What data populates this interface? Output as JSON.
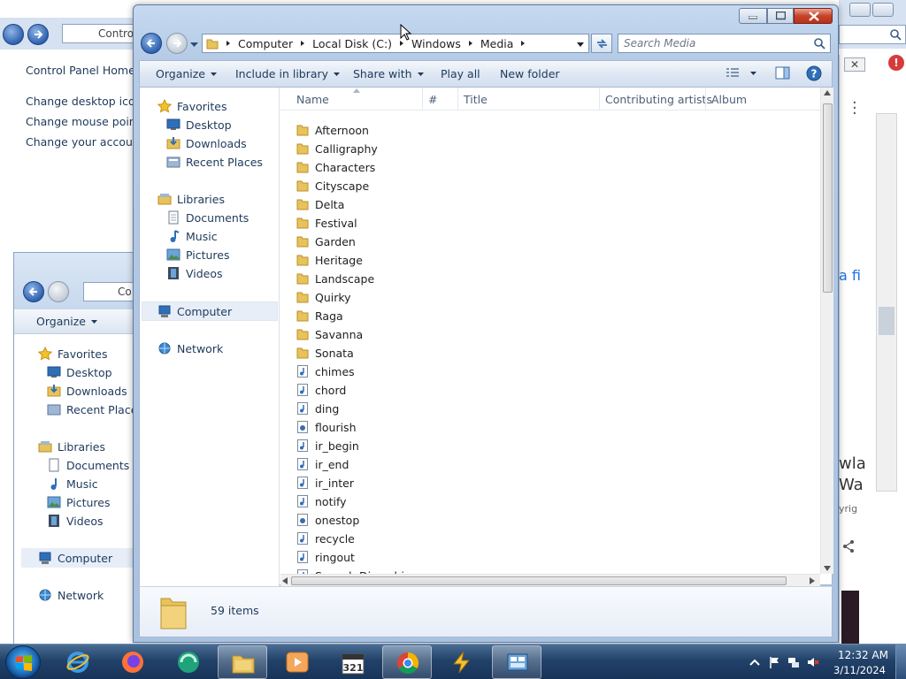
{
  "control_panel": {
    "address_text": "Contro",
    "home_link": "Control Panel Home",
    "links": [
      "Change desktop icons",
      "Change mouse pointer",
      "Change your account p"
    ]
  },
  "explorer2": {
    "address_text": "Co",
    "organize_label": "Organize",
    "favorites": "Favorites",
    "desktop": "Desktop",
    "downloads": "Downloads",
    "recent": "Recent Places",
    "libraries": "Libraries",
    "documents": "Documents",
    "music": "Music",
    "pictures": "Pictures",
    "videos": "Videos",
    "computer": "Computer",
    "network": "Network"
  },
  "bg_right": {
    "close_glyph": "✕",
    "alert_glyph": "!",
    "text_a": "a fi",
    "text_wla": "wla",
    "text_wa": "Wa",
    "text_yrig": "yrig"
  },
  "main": {
    "address": {
      "crumbs": [
        "Computer",
        "Local Disk (C:)",
        "Windows",
        "Media"
      ]
    },
    "search": {
      "placeholder": "Search Media"
    },
    "toolbar": {
      "organize": "Organize",
      "include_in_library": "Include in library",
      "share_with": "Share with",
      "play_all": "Play all",
      "new_folder": "New folder"
    },
    "nav": {
      "favorites": "Favorites",
      "desktop": "Desktop",
      "downloads": "Downloads",
      "recent": "Recent Places",
      "libraries": "Libraries",
      "documents": "Documents",
      "music": "Music",
      "pictures": "Pictures",
      "videos": "Videos",
      "computer": "Computer",
      "network": "Network"
    },
    "columns": [
      "Name",
      "#",
      "Title",
      "Contributing artists",
      "Album"
    ],
    "files": [
      {
        "name": "Afternoon",
        "type": "folder"
      },
      {
        "name": "Calligraphy",
        "type": "folder"
      },
      {
        "name": "Characters",
        "type": "folder"
      },
      {
        "name": "Cityscape",
        "type": "folder"
      },
      {
        "name": "Delta",
        "type": "folder"
      },
      {
        "name": "Festival",
        "type": "folder"
      },
      {
        "name": "Garden",
        "type": "folder"
      },
      {
        "name": "Heritage",
        "type": "folder"
      },
      {
        "name": "Landscape",
        "type": "folder"
      },
      {
        "name": "Quirky",
        "type": "folder"
      },
      {
        "name": "Raga",
        "type": "folder"
      },
      {
        "name": "Savanna",
        "type": "folder"
      },
      {
        "name": "Sonata",
        "type": "folder"
      },
      {
        "name": "chimes",
        "type": "audio"
      },
      {
        "name": "chord",
        "type": "audio"
      },
      {
        "name": "ding",
        "type": "audio"
      },
      {
        "name": "flourish",
        "type": "midi"
      },
      {
        "name": "ir_begin",
        "type": "audio"
      },
      {
        "name": "ir_end",
        "type": "audio"
      },
      {
        "name": "ir_inter",
        "type": "audio"
      },
      {
        "name": "notify",
        "type": "audio"
      },
      {
        "name": "onestop",
        "type": "midi"
      },
      {
        "name": "recycle",
        "type": "audio"
      },
      {
        "name": "ringout",
        "type": "audio"
      },
      {
        "name": "Speech Disambiqua...",
        "type": "audio"
      }
    ],
    "status": {
      "item_count": "59 items"
    }
  },
  "taskbar": {
    "time": "12:32 AM",
    "date": "3/11/2024"
  },
  "colors": {
    "folder": "#e8c25a",
    "window_frame": "#b5cbe6",
    "taskbar": "#22426a"
  }
}
